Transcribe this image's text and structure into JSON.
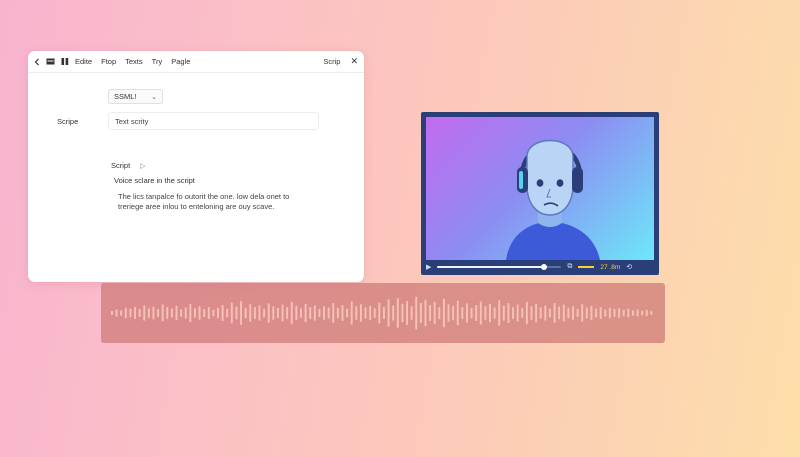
{
  "editor": {
    "toolbar": {
      "menu_items": [
        "Edite",
        "Ftop",
        "Texts",
        "Try",
        "Pagle"
      ],
      "right_title": "Scrip",
      "close_label": "✕"
    },
    "ssml_select": {
      "value": "SSML!",
      "chevron": "⌄"
    },
    "field": {
      "label": "Scripe",
      "value": "Text scrity"
    },
    "script": {
      "heading": "Script",
      "play_icon": "▷"
    },
    "note": "Voice sclare in the script",
    "body": [
      "The  lics tanpalce fo outorit the one. low dela onet to",
      "treriege aree inlou to enteloning are ouy scave."
    ]
  },
  "player": {
    "time_label": "27 .8m",
    "progress": 0.86,
    "icons": [
      "play-icon",
      "captions-icon",
      "volume-icon",
      "loop-icon"
    ]
  },
  "waveform": {
    "color": "#f6c1b7",
    "levels": [
      0.1,
      0.18,
      0.14,
      0.26,
      0.22,
      0.3,
      0.2,
      0.38,
      0.24,
      0.32,
      0.2,
      0.42,
      0.3,
      0.22,
      0.36,
      0.18,
      0.28,
      0.46,
      0.24,
      0.34,
      0.2,
      0.3,
      0.16,
      0.26,
      0.4,
      0.22,
      0.52,
      0.32,
      0.6,
      0.26,
      0.44,
      0.3,
      0.38,
      0.22,
      0.48,
      0.34,
      0.26,
      0.42,
      0.3,
      0.56,
      0.36,
      0.24,
      0.46,
      0.3,
      0.38,
      0.2,
      0.34,
      0.28,
      0.5,
      0.26,
      0.4,
      0.22,
      0.58,
      0.34,
      0.44,
      0.28,
      0.36,
      0.24,
      0.52,
      0.3,
      0.68,
      0.38,
      0.74,
      0.46,
      0.6,
      0.34,
      0.82,
      0.5,
      0.66,
      0.4,
      0.56,
      0.3,
      0.72,
      0.44,
      0.36,
      0.62,
      0.3,
      0.48,
      0.26,
      0.4,
      0.58,
      0.34,
      0.46,
      0.28,
      0.64,
      0.38,
      0.5,
      0.3,
      0.42,
      0.24,
      0.56,
      0.34,
      0.46,
      0.28,
      0.38,
      0.22,
      0.5,
      0.32,
      0.42,
      0.26,
      0.34,
      0.2,
      0.44,
      0.28,
      0.36,
      0.22,
      0.3,
      0.18,
      0.26,
      0.2,
      0.24,
      0.16,
      0.22,
      0.14,
      0.18,
      0.12,
      0.16,
      0.1
    ]
  }
}
